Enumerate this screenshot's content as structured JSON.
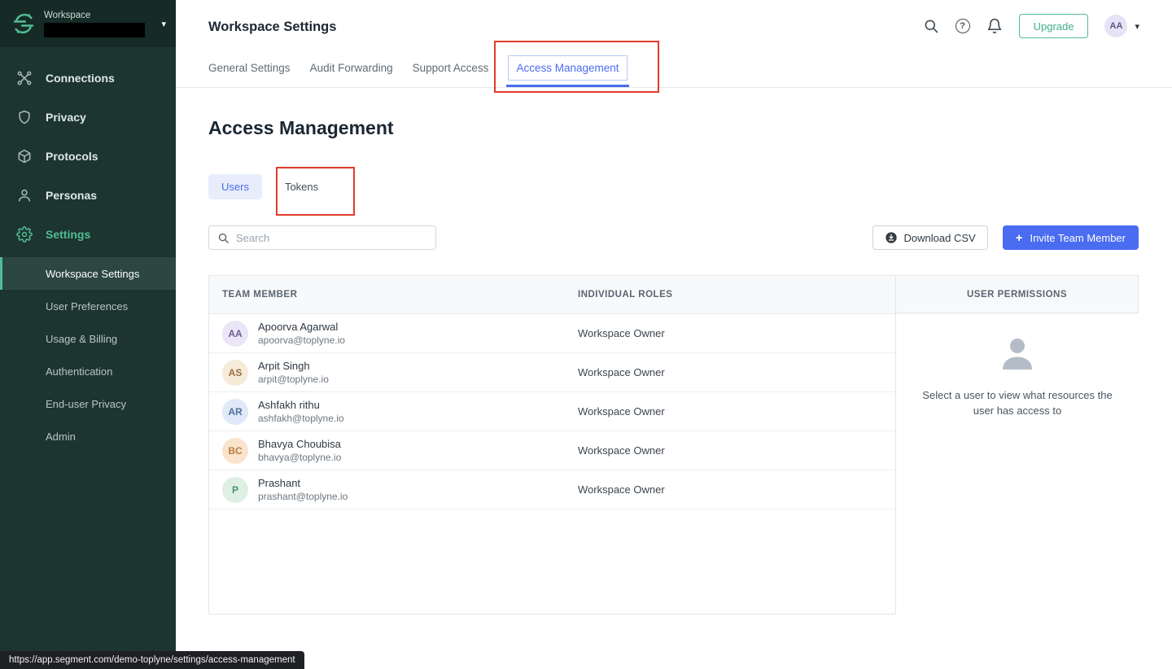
{
  "glyphs": {
    "caret_down": "▾",
    "plus": "+",
    "question": "?"
  },
  "colors": {
    "sidebar_bg": "#1d3531",
    "accent_green": "#52bd94",
    "accent_blue": "#4a6cf0",
    "annotation_red": "#e23a2a"
  },
  "sidebar": {
    "workspace_label": "Workspace",
    "workspace_name_redacted": true,
    "nav": [
      {
        "label": "Connections",
        "icon": "connections-icon"
      },
      {
        "label": "Privacy",
        "icon": "shield-icon"
      },
      {
        "label": "Protocols",
        "icon": "protocols-icon"
      },
      {
        "label": "Personas",
        "icon": "personas-icon"
      },
      {
        "label": "Settings",
        "icon": "gear-icon",
        "active": true
      }
    ],
    "settings_subnav": [
      {
        "label": "Workspace Settings",
        "active": true
      },
      {
        "label": "User Preferences"
      },
      {
        "label": "Usage & Billing"
      },
      {
        "label": "Authentication"
      },
      {
        "label": "End-user Privacy"
      },
      {
        "label": "Admin"
      }
    ]
  },
  "header": {
    "title": "Workspace Settings",
    "tabs": [
      {
        "label": "General Settings"
      },
      {
        "label": "Audit Forwarding"
      },
      {
        "label": "Support Access"
      },
      {
        "label": "Access Management",
        "active": true
      }
    ],
    "upgrade_label": "Upgrade",
    "avatar_initials": "AA"
  },
  "main": {
    "title": "Access Management",
    "view_tabs": [
      {
        "label": "Users",
        "active": true
      },
      {
        "label": "Tokens"
      }
    ],
    "search": {
      "placeholder": "Search"
    },
    "download_csv_label": "Download CSV",
    "invite_label": "Invite Team Member",
    "table": {
      "columns": [
        "TEAM MEMBER",
        "INDIVIDUAL ROLES"
      ],
      "rows": [
        {
          "initials": "AA",
          "name": "Apoorva Agarwal",
          "email": "apoorva@toplyne.io",
          "role": "Workspace Owner",
          "avatar_bg": "#eae6f7",
          "avatar_color": "#6c5e93"
        },
        {
          "initials": "AS",
          "name": "Arpit Singh",
          "email": "arpit@toplyne.io",
          "role": "Workspace Owner",
          "avatar_bg": "#f6ead9",
          "avatar_color": "#9c7040"
        },
        {
          "initials": "AR",
          "name": "Ashfakh rithu",
          "email": "ashfakh@toplyne.io",
          "role": "Workspace Owner",
          "avatar_bg": "#dfe9f7",
          "avatar_color": "#4f6f9e"
        },
        {
          "initials": "BC",
          "name": "Bhavya Choubisa",
          "email": "bhavya@toplyne.io",
          "role": "Workspace Owner",
          "avatar_bg": "#f9e4cd",
          "avatar_color": "#bf7b39"
        },
        {
          "initials": "P",
          "name": "Prashant",
          "email": "prashant@toplyne.io",
          "role": "Workspace Owner",
          "avatar_bg": "#ddf0e3",
          "avatar_color": "#46936a"
        }
      ]
    },
    "permissions_panel": {
      "title": "USER PERMISSIONS",
      "empty_text": "Select a user to view what resources the user has access to"
    }
  },
  "statusbar": {
    "url": "https://app.segment.com/demo-toplyne/settings/access-management"
  }
}
